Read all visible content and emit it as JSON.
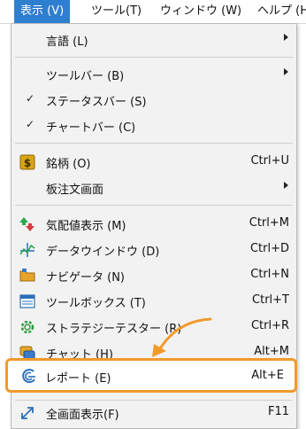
{
  "menubar": {
    "items": [
      {
        "label": "表示 (V)"
      },
      {
        "label": "ツール(T)"
      },
      {
        "label": "ウィンドウ (W)"
      },
      {
        "label": "ヘルプ (H"
      }
    ]
  },
  "menu": {
    "language": {
      "label": "言語 (L)"
    },
    "toolbar": {
      "label": "ツールバー (B)"
    },
    "statusbar": {
      "label": "ステータスバー (S)",
      "check": "✓"
    },
    "chartbar": {
      "label": "チャートバー (C)",
      "check": "✓"
    },
    "symbols": {
      "label": "銘柄 (O)",
      "shortcut": "Ctrl+U",
      "icon": "dollar-icon"
    },
    "depth": {
      "label": "板注文画面"
    },
    "quotes": {
      "label": "気配値表示 (M)",
      "shortcut": "Ctrl+M",
      "icon": "quotes-icon"
    },
    "datawindow": {
      "label": "データウインドウ (D)",
      "shortcut": "Ctrl+D",
      "icon": "datawindow-icon"
    },
    "navigator": {
      "label": "ナビゲータ (N)",
      "shortcut": "Ctrl+N",
      "icon": "folder-icon"
    },
    "toolbox": {
      "label": "ツールボックス (T)",
      "shortcut": "Ctrl+T",
      "icon": "toolbox-icon"
    },
    "tester": {
      "label": "ストラテジーテスター (R)",
      "shortcut": "Ctrl+R",
      "icon": "gear-icon"
    },
    "chat": {
      "label": "チャット (H)",
      "shortcut": "Alt+M",
      "icon": "chat-icon"
    },
    "report": {
      "label": "レポート (E)",
      "shortcut": "Alt+E",
      "icon": "report-icon"
    },
    "fullscreen": {
      "label": "全画面表示(F)",
      "shortcut": "F11",
      "icon": "fullscreen-icon"
    }
  },
  "colors": {
    "highlight_border": "#f19a2c",
    "menubar_active": "#2f7fd0"
  }
}
